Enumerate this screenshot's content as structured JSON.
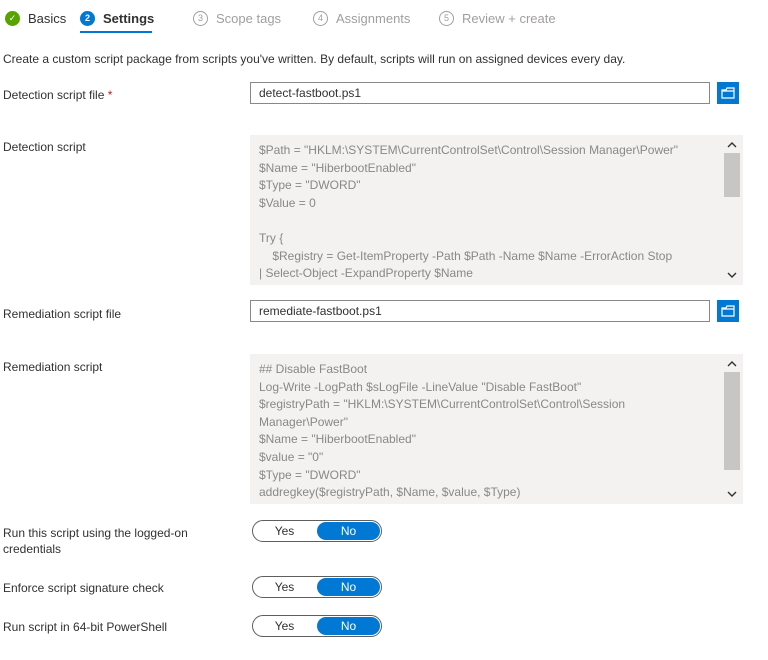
{
  "tabs": [
    {
      "number": "✓",
      "label": "Basics",
      "state": "done"
    },
    {
      "number": "2",
      "label": "Settings",
      "state": "active"
    },
    {
      "number": "3",
      "label": "Scope tags",
      "state": "inactive"
    },
    {
      "number": "4",
      "label": "Assignments",
      "state": "inactive"
    },
    {
      "number": "5",
      "label": "Review + create",
      "state": "inactive"
    }
  ],
  "intro": "Create a custom script package from scripts you've written. By default, scripts will run on assigned devices every day.",
  "detection_file": {
    "label": "Detection script file",
    "required_mark": "*",
    "value": "detect-fastboot.ps1",
    "browse_icon": "folder-open-icon"
  },
  "detection_script": {
    "label": "Detection script",
    "lines": [
      "$Path = \"HKLM:\\SYSTEM\\CurrentControlSet\\Control\\Session Manager\\Power\"",
      "$Name = \"HiberbootEnabled\"",
      "$Type = \"DWORD\"",
      "$Value = 0",
      "",
      "Try {",
      "    $Registry = Get-ItemProperty -Path $Path -Name $Name -ErrorAction Stop",
      "| Select-Object -ExpandProperty $Name"
    ],
    "scroll_position": 0
  },
  "remediation_file": {
    "label": "Remediation script file",
    "value": "remediate-fastboot.ps1",
    "browse_icon": "folder-open-icon"
  },
  "remediation_script": {
    "label": "Remediation script",
    "lines": [
      "## Disable FastBoot",
      "Log-Write -LogPath $sLogFile -LineValue \"Disable FastBoot\"",
      "$registryPath = \"HKLM:\\SYSTEM\\CurrentControlSet\\Control\\Session",
      "Manager\\Power\"",
      "$Name = \"HiberbootEnabled\"",
      "$value = \"0\"",
      "$Type = \"DWORD\"",
      "addregkey($registryPath, $Name, $value, $Type)"
    ],
    "scroll_position": 0
  },
  "toggles": [
    {
      "label": "Run this script using the logged-on credentials",
      "yes": "Yes",
      "no": "No",
      "selected": "No"
    },
    {
      "label": "Enforce script signature check",
      "yes": "Yes",
      "no": "No",
      "selected": "No"
    },
    {
      "label": "Run script in 64-bit PowerShell",
      "yes": "Yes",
      "no": "No",
      "selected": "No"
    }
  ],
  "colors": {
    "accent": "#0078d4",
    "success": "#57a300",
    "required": "#a4262c"
  }
}
